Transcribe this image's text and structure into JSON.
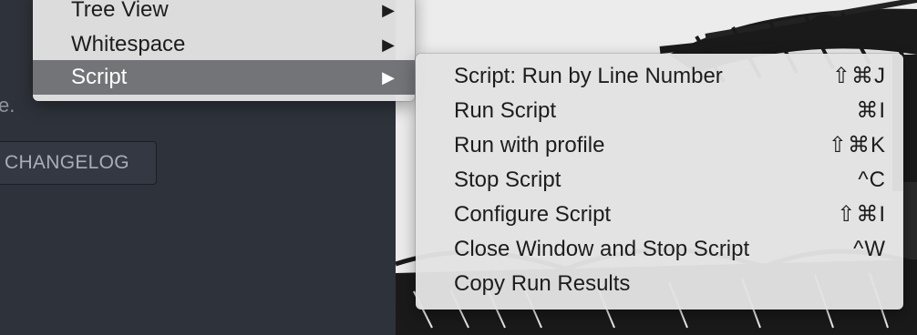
{
  "app_pane": {
    "text_fragment": "e.",
    "changelog_button_label": "CHANGELOG"
  },
  "parent_menu": {
    "items": [
      {
        "label": "Tree View",
        "has_submenu": true,
        "arrow_icon": "triangle-right-icon"
      },
      {
        "label": "Whitespace",
        "has_submenu": true,
        "arrow_icon": "triangle-right-icon"
      },
      {
        "label": "Script",
        "has_submenu": true,
        "highlighted": true,
        "arrow_icon": "triangle-right-icon"
      }
    ],
    "arrow_glyph": "▶"
  },
  "script_submenu": {
    "items": [
      {
        "label": "Script: Run by Line Number",
        "shortcut": "⇧⌘J"
      },
      {
        "label": "Run Script",
        "shortcut": "⌘I"
      },
      {
        "label": "Run with profile",
        "shortcut": "⇧⌘K"
      },
      {
        "label": "Stop Script",
        "shortcut": "^C"
      },
      {
        "label": "Configure Script",
        "shortcut": "⇧⌘I"
      },
      {
        "label": "Close Window and Stop Script",
        "shortcut": "^W"
      },
      {
        "label": "Copy Run Results",
        "shortcut": ""
      }
    ]
  },
  "colors": {
    "app_background": "#2e323a",
    "menu_background": "#e2e2e2",
    "menu_highlight": "#727478",
    "wallpaper_light": "#ececec",
    "wallpaper_dark": "#1a1a1a"
  }
}
